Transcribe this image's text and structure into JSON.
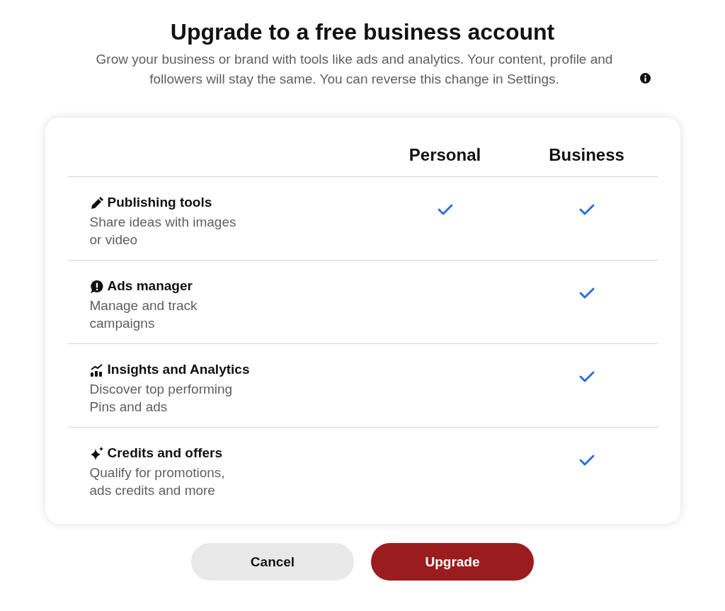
{
  "title": "Upgrade to a free business account",
  "subtitle": "Grow your business or brand with tools like ads and analytics. Your content, profile and followers will stay the same. You can reverse this change in Settings.",
  "columns": [
    "Personal",
    "Business"
  ],
  "features": [
    {
      "kind": "pencil",
      "name": "Publishing tools",
      "description": "Share ideas with images or video",
      "personal": true,
      "business": true
    },
    {
      "kind": "alert",
      "name": "Ads manager",
      "description": "Manage and track campaigns",
      "personal": false,
      "business": true
    },
    {
      "kind": "chart",
      "name": "Insights and Analytics",
      "description": "Discover top performing Pins and ads",
      "personal": false,
      "business": true
    },
    {
      "kind": "sparkle",
      "name": "Credits and offers",
      "description": "Qualify for promotions, ads credits and more",
      "personal": false,
      "business": true
    }
  ],
  "buttons": [
    {
      "label": "Cancel",
      "kind": "secondary"
    },
    {
      "label": "Upgrade",
      "kind": "primary"
    }
  ]
}
